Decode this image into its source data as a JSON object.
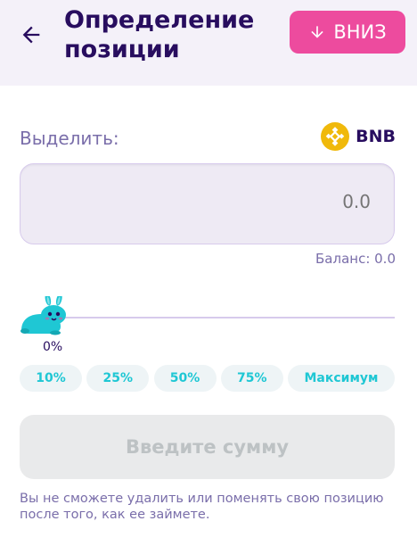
{
  "header": {
    "title": "Определение позиции",
    "down_button_label": "ВНИЗ"
  },
  "form": {
    "allocate_label": "Выделить:",
    "token_symbol": "BNB",
    "amount_value": "0.0",
    "balance_text": "Баланс: 0.0",
    "slider_percent_label": "0%",
    "slider_percent": 0,
    "percent_buttons": [
      "10%",
      "25%",
      "50%",
      "75%",
      "Максимум"
    ],
    "submit_label": "Введите сумму",
    "note": "Вы не сможете удалить или поменять свою позицию после того, как ее займете."
  },
  "colors": {
    "primary_text": "#280d5f",
    "secondary_text": "#7a6eaa",
    "accent_pink": "#ed4b9e",
    "accent_cyan": "#1fc7d4",
    "bnb_yellow": "#f0b90b"
  }
}
